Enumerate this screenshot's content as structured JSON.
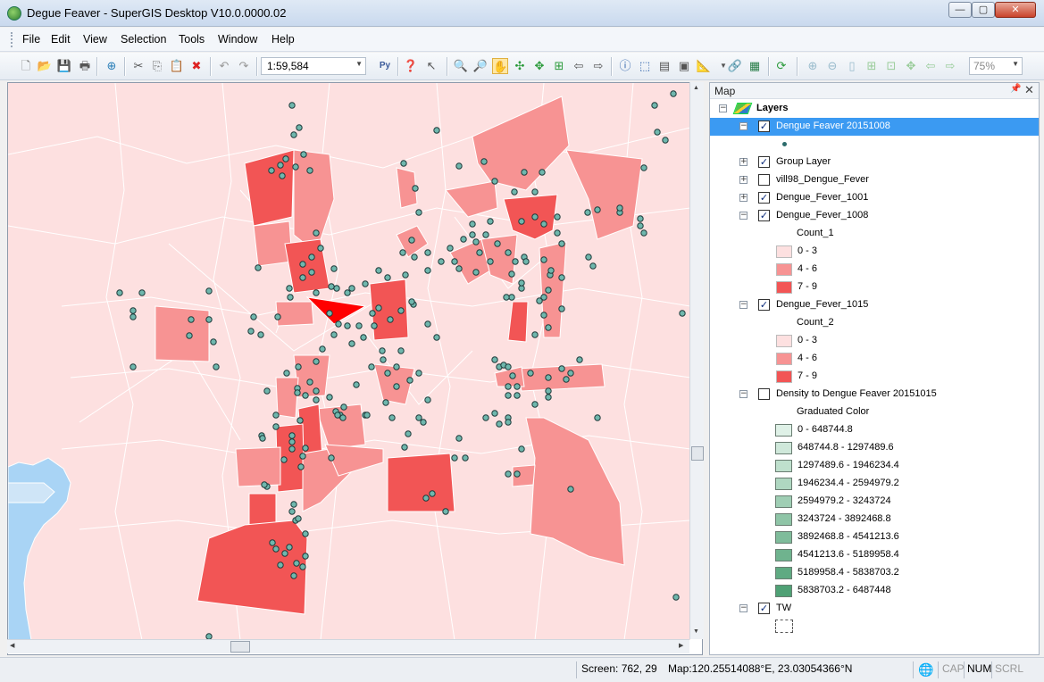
{
  "window": {
    "title": "Degue Feaver - SuperGIS Desktop V10.0.0000.02"
  },
  "menu": [
    "File",
    "Edit",
    "View",
    "Selection",
    "Tools",
    "Window",
    "Help"
  ],
  "toolbar": {
    "scale": "1:59,584",
    "zoom": "75%"
  },
  "map_panel": {
    "title": "Map",
    "root_label": "Layers"
  },
  "layers": [
    {
      "label": "Dengue Feaver 20151008",
      "checked": true,
      "selected": true
    },
    {
      "label": "Group Layer",
      "checked": true
    },
    {
      "label": "vill98_Dengue_Fever",
      "checked": false
    },
    {
      "label": "Dengue_Fever_1001",
      "checked": true
    },
    {
      "label": "Dengue_Fever_1008",
      "checked": true,
      "field": "Count_1",
      "classes": [
        {
          "label": "0 - 3",
          "color": "#fde0e0"
        },
        {
          "label": "4 - 6",
          "color": "#f79393"
        },
        {
          "label": "7 - 9",
          "color": "#f25555"
        }
      ]
    },
    {
      "label": "Dengue_Fever_1015",
      "checked": true,
      "field": "Count_2",
      "classes": [
        {
          "label": "0 - 3",
          "color": "#fde0e0"
        },
        {
          "label": "4 - 6",
          "color": "#f79393"
        },
        {
          "label": "7 - 9",
          "color": "#f25555"
        }
      ]
    },
    {
      "label": "Density to Dengue Feaver 20151015",
      "checked": false,
      "field": "Graduated Color",
      "classes": [
        {
          "label": "0 - 648744.8",
          "color": "#dff1e7"
        },
        {
          "label": "648744.8 - 1297489.6",
          "color": "#cfe8da"
        },
        {
          "label": "1297489.6 - 1946234.4",
          "color": "#bfe0cd"
        },
        {
          "label": "1946234.4 - 2594979.2",
          "color": "#afd7c1"
        },
        {
          "label": "2594979.2 - 3243724",
          "color": "#9fceb4"
        },
        {
          "label": "3243724 - 3892468.8",
          "color": "#8fc5a7"
        },
        {
          "label": "3892468.8 - 4541213.6",
          "color": "#7fbc9b"
        },
        {
          "label": "4541213.6 - 5189958.4",
          "color": "#6fb38e"
        },
        {
          "label": "5189958.4 - 5838703.2",
          "color": "#5faa82"
        },
        {
          "label": "5838703.2 - 6487448",
          "color": "#4fa175"
        }
      ]
    },
    {
      "label": "TW",
      "checked": true
    }
  ],
  "status": {
    "screen": "Screen: 762, 29",
    "map": "Map:120.25514088°E, 23.03054366°N",
    "caps": "CAP",
    "num": "NUM",
    "scroll": "SCRL"
  },
  "colors": {
    "base_polygon": "#fde0e0",
    "mid_polygon": "#f79393",
    "high_polygon": "#f25555",
    "max_polygon": "#ff0000",
    "sea": "#a9d4f5",
    "point": "#6fb7ad",
    "selection": "#3b9af2"
  }
}
